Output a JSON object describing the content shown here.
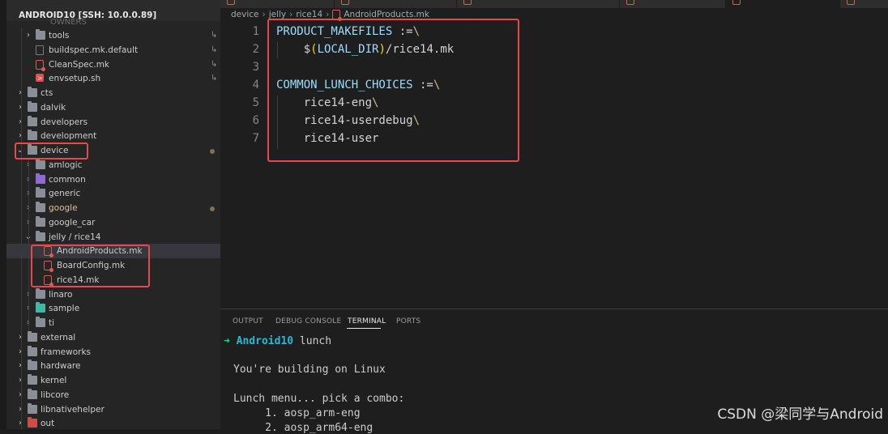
{
  "explorer": {
    "title": "ANDROID10 [SSH: 10.0.0.89]",
    "ghost_label": "OWNERS",
    "items": [
      {
        "label": "tools",
        "kind": "folder",
        "chev": "›",
        "right": "↳"
      },
      {
        "label": "buildspec.mk.default",
        "kind": "file",
        "right": "↳"
      },
      {
        "label": "CleanSpec.mk",
        "kind": "mk",
        "right": "↳"
      },
      {
        "label": "envsetup.sh",
        "kind": "sh",
        "right": "↳"
      },
      {
        "label": "cts",
        "kind": "folder",
        "chev": "›"
      },
      {
        "label": "dalvik",
        "kind": "folder",
        "chev": "›"
      },
      {
        "label": "developers",
        "kind": "folder",
        "chev": "›"
      },
      {
        "label": "development",
        "kind": "folder",
        "chev": "›"
      },
      {
        "label": "device",
        "kind": "folder",
        "chev": "⌄",
        "dot": true
      },
      {
        "label": "amlogic",
        "kind": "folder",
        "chev": "›"
      },
      {
        "label": "common",
        "kind": "folder-purple",
        "chev": "›"
      },
      {
        "label": "generic",
        "kind": "folder",
        "chev": "›"
      },
      {
        "label": "google",
        "kind": "folder",
        "chev": "›",
        "dot": true,
        "yellow": true
      },
      {
        "label": "google_car",
        "kind": "folder",
        "chev": "›"
      },
      {
        "label": "jelly / rice14",
        "kind": "folder",
        "chev": "⌄"
      },
      {
        "label": "AndroidProducts.mk",
        "kind": "mk",
        "selected": true
      },
      {
        "label": "BoardConfig.mk",
        "kind": "mk"
      },
      {
        "label": "rice14.mk",
        "kind": "mk"
      },
      {
        "label": "linaro",
        "kind": "folder",
        "chev": "›"
      },
      {
        "label": "sample",
        "kind": "folder-teal",
        "chev": "›"
      },
      {
        "label": "ti",
        "kind": "folder",
        "chev": "›"
      },
      {
        "label": "external",
        "kind": "folder",
        "chev": "›"
      },
      {
        "label": "frameworks",
        "kind": "folder",
        "chev": "›"
      },
      {
        "label": "hardware",
        "kind": "folder",
        "chev": "›"
      },
      {
        "label": "kernel",
        "kind": "folder",
        "chev": "›"
      },
      {
        "label": "libcore",
        "kind": "folder",
        "chev": "›"
      },
      {
        "label": "libnativehelper",
        "kind": "folder",
        "chev": "›"
      },
      {
        "label": "out",
        "kind": "folder-red",
        "chev": "›"
      }
    ]
  },
  "breadcrumb": {
    "parts": [
      "device",
      "jelly",
      "rice14",
      "AndroidProducts.mk"
    ],
    "separator": "›"
  },
  "editor": {
    "line_numbers": [
      "1",
      "2",
      "3",
      "4",
      "5",
      "6",
      "7"
    ],
    "lines": {
      "l1_var": "PRODUCT_MAKEFILES",
      "l1_op": " :=",
      "l1_bs": "\\",
      "l2_dollar": "$",
      "l2_open": "(",
      "l2_var": "LOCAL_DIR",
      "l2_close": ")",
      "l2_rest": "/rice14.mk",
      "l4_var": "COMMON_LUNCH_CHOICES",
      "l4_op": " :=",
      "l4_bs": "\\",
      "l5_text": "rice14-eng",
      "l5_bs": "\\",
      "l6_text": "rice14-userdebug",
      "l6_bs": "\\",
      "l7_text": "rice14-user"
    }
  },
  "panel": {
    "tabs": [
      "OUTPUT",
      "DEBUG CONSOLE",
      "TERMINAL",
      "PORTS"
    ],
    "active_tab": "TERMINAL",
    "terminal": {
      "prompt_arrow": "➜",
      "prompt_dir": "Android10",
      "prompt_cmd": " lunch",
      "line2": "You're building on Linux",
      "line3": "Lunch menu... pick a combo:",
      "line4": "     1. aosp_arm-eng",
      "line5": "     2. aosp_arm64-eng"
    }
  },
  "watermark": "CSDN @梁同学与Android",
  "colors": {
    "highlight_box": "#e8484b",
    "sidebar_bg": "#252526",
    "editor_bg": "#1e1e1e",
    "keyword": "#9cdcfe",
    "bracket": "#ffd700",
    "prompt_arrow": "#23d18b",
    "prompt_dir": "#29b8db"
  }
}
